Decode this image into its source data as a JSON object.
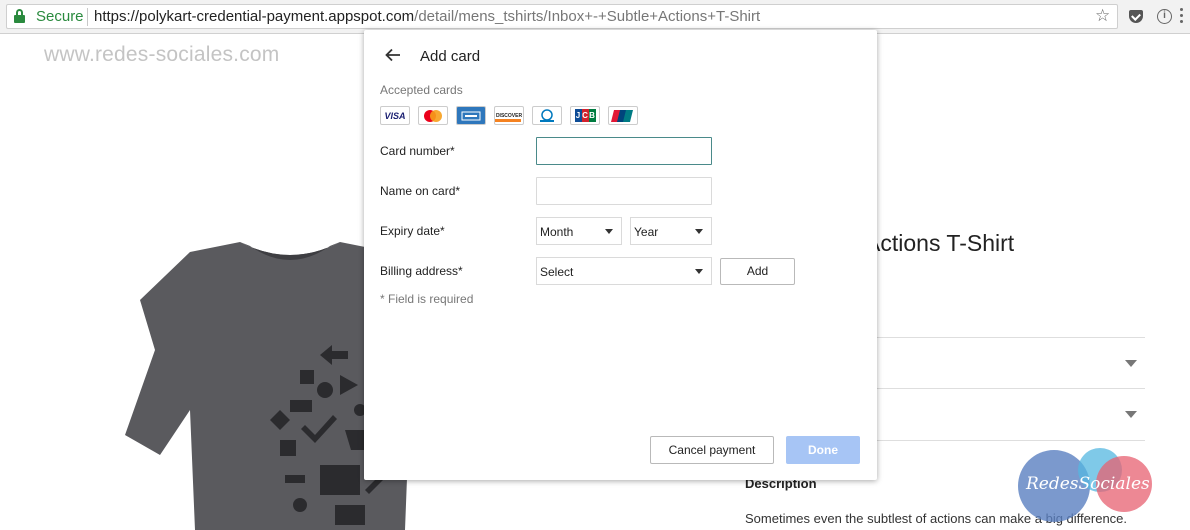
{
  "browser": {
    "secure_label": "Secure",
    "url_host": "https://polykart-credential-payment.appspot.com",
    "url_path": "/detail/mens_tshirts/Inbox+-+Subtle+Actions+T-Shirt"
  },
  "page": {
    "watermark": "www.redes-sociales.com",
    "product_title": "le Actions T-Shirt",
    "description_title": "Description",
    "description_text": "Sometimes even the subtlest of actions can make a big difference."
  },
  "modal": {
    "title": "Add card",
    "accepted_label": "Accepted cards",
    "cards": [
      {
        "name": "visa-card-icon",
        "label": "VISA"
      },
      {
        "name": "mastercard-card-icon",
        "label": ""
      },
      {
        "name": "amex-card-icon",
        "label": ""
      },
      {
        "name": "discover-card-icon",
        "label": "DISCOVER"
      },
      {
        "name": "diners-card-icon",
        "label": ""
      },
      {
        "name": "jcb-card-icon",
        "label": "JCB"
      },
      {
        "name": "unionpay-card-icon",
        "label": ""
      }
    ],
    "fields": {
      "card_number_label": "Card number*",
      "card_number_value": "",
      "name_label": "Name on card*",
      "name_value": "",
      "expiry_label": "Expiry date*",
      "month_value": "Month",
      "year_value": "Year",
      "billing_label": "Billing address*",
      "billing_value": "Select"
    },
    "add_label": "Add",
    "required_note": "* Field is required",
    "cancel_label": "Cancel payment",
    "done_label": "Done"
  },
  "logo": {
    "text": "RedesSociales"
  },
  "colors": {
    "secure_green": "#2a8a3e",
    "done_disabled": "#a7c5f5",
    "focus_border": "#4a8a8a"
  }
}
